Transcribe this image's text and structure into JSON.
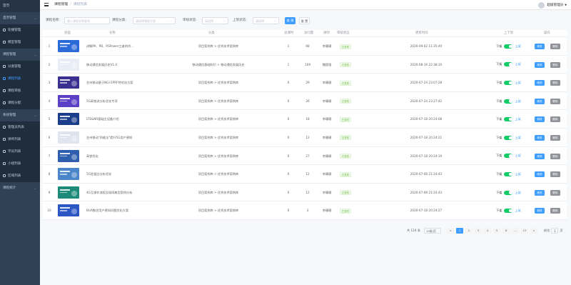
{
  "sidebar": {
    "items": [
      {
        "label": "首页",
        "top": true
      },
      {
        "label": "首页管理",
        "group": true
      },
      {
        "label": "轮播管理",
        "sub": true
      },
      {
        "label": "模型管理",
        "sub": true
      },
      {
        "label": "课程管理",
        "group": true
      },
      {
        "label": "分类管理",
        "sub": true
      },
      {
        "label": "课程列表",
        "sub": true,
        "active": true
      },
      {
        "label": "课程审核",
        "sub": true
      },
      {
        "label": "课程分配",
        "sub": true
      },
      {
        "label": "系统管理",
        "group": true
      },
      {
        "label": "管理员列表",
        "sub": true
      },
      {
        "label": "讲师列表",
        "sub": true
      },
      {
        "label": "学员列表",
        "sub": true
      },
      {
        "label": "小组列表",
        "sub": true
      },
      {
        "label": "区域列表",
        "sub": true
      },
      {
        "label": "课程统计",
        "group": true
      }
    ]
  },
  "header": {
    "crumbs": [
      "课程管理",
      "课程列表"
    ],
    "username": "超级管理员"
  },
  "filters": {
    "name_label": "课程名称:",
    "name_placeholder": "输入课程名称查询",
    "category_label": "课程分类:",
    "category_placeholder": "请选择课程分类",
    "audit_label": "审核状态:",
    "audit_placeholder": "请选择",
    "shelf_label": "上架状态:",
    "shelf_placeholder": "请选择",
    "search_label": "查 询",
    "reset_label": "重 置"
  },
  "table": {
    "headers": [
      "封面",
      "名称",
      "分类",
      "总课时",
      "访问量",
      "讲师",
      "审核状态",
      "更新时间",
      "上下架",
      "操作"
    ],
    "rows": [
      {
        "index": "1",
        "name": "讲解PA、PB、RSPower三者的作...",
        "category": "项目案例库 > 优秀技术案例库",
        "hours": "1",
        "views": "68",
        "teacher": "李珊珊",
        "status": "已发布",
        "time": "2020-09-02 11:35:40",
        "cover": "#2b6bd8"
      },
      {
        "index": "2",
        "name": "移动通信发展历史V1.0",
        "category": "移动通信基础知识 > 移动通信发展历史",
        "hours": "1",
        "views": "109",
        "teacher": "魏国强",
        "status": "已发布",
        "time": "2020-08-16 22:38:10",
        "cover": "#e9edf5"
      },
      {
        "index": "3",
        "name": "台州移动基于NGI EPRF特优化方案",
        "category": "项目案例库 > 优秀技术案例库",
        "hours": "0",
        "views": "29",
        "teacher": "李珊珊",
        "status": "已发布",
        "time": "2020-07-24 23:07:28",
        "cover": "#3b2f8f"
      },
      {
        "index": "4",
        "name": "5G高铁流分析优化专项",
        "category": "项目案例库 > 优秀技术案例库",
        "hours": "0",
        "views": "26",
        "teacher": "李珊珊",
        "status": "已发布",
        "time": "2020-07-24 23:27:42",
        "cover": "#5b3fc4"
      },
      {
        "index": "5",
        "name": "LTE&NR基础主设备介绍",
        "category": "项目案例库 > 优秀技术案例库",
        "hours": "0",
        "views": "18",
        "teacher": "李珊珊",
        "status": "已发布",
        "time": "2020-07-18 20:24:08",
        "cover": "#1b3e8c"
      },
      {
        "index": "6",
        "name": "台州移动\"四维法\"提升5G用户感知",
        "category": "项目案例库 > 优秀技术案例库",
        "hours": "0",
        "views": "12",
        "teacher": "李珊珊",
        "status": "已发布",
        "time": "2020-07-18 20:24:21",
        "cover": "#dfe5ef"
      },
      {
        "index": "7",
        "name": "高铁优化",
        "category": "项目案例库 > 优秀技术案例库",
        "hours": "0",
        "views": "27",
        "teacher": "李珊珊",
        "status": "已发布",
        "time": "2020-07-18 20:24:19",
        "cover": "#2e5fae"
      },
      {
        "index": "8",
        "name": "5G驻留比分析优化",
        "category": "项目案例库 > 优秀技术案例库",
        "hours": "0",
        "views": "12",
        "teacher": "李珊珊",
        "status": "已发布",
        "time": "2020-07-08 21:24:43",
        "cover": "#4a86c9"
      },
      {
        "index": "9",
        "name": "4G互操作流程及现网典型案例分析",
        "category": "项目案例库 > 优秀技术案例库",
        "hours": "0",
        "views": "12",
        "teacher": "李珊珊",
        "status": "已发布",
        "time": "2020-07-08 21:24:43",
        "cover": "#1e8a7a"
      },
      {
        "index": "10",
        "name": "BUA数优用户感知问题优化方案",
        "category": "项目案例库 > 优秀技术案例库",
        "hours": "0",
        "views": "3",
        "teacher": "李珊珊",
        "status": "已发布",
        "time": "2020-07-18 20:24:27",
        "cover": "#2c56c4"
      }
    ],
    "shelf_down": "下架",
    "shelf_up": "上架",
    "edit_label": "修改",
    "delete_label": "删除"
  },
  "pagination": {
    "total": "共 124 条",
    "page_size": "10条/页",
    "prev": "<",
    "pages": [
      "1",
      "2",
      "3",
      "4",
      "5",
      "6",
      "...",
      "13"
    ],
    "next": ">",
    "goto_label": "前往",
    "goto_value": "1",
    "page_suffix": "页"
  },
  "colors": {
    "sidebar_bg": "#304156",
    "primary": "#409eff",
    "success": "#13ce66"
  }
}
